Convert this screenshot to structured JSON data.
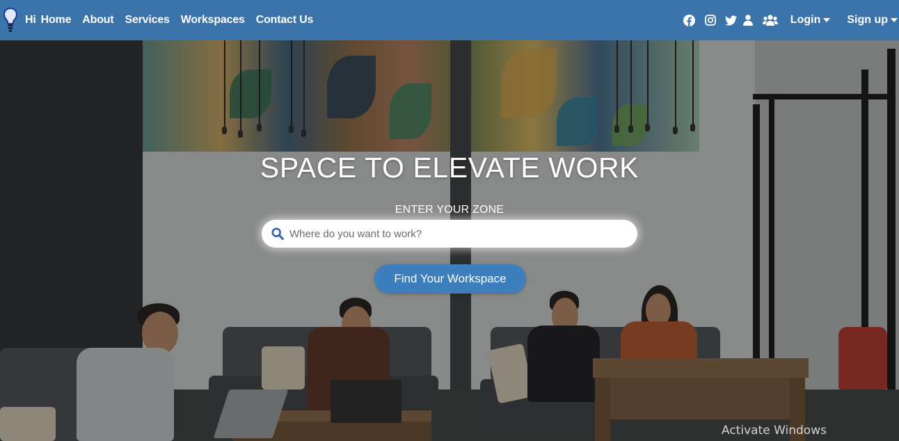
{
  "navbar": {
    "logo_icon": "lightbulb-icon",
    "links": [
      {
        "label": "Hi"
      },
      {
        "label": "Home"
      },
      {
        "label": "About"
      },
      {
        "label": "Services"
      },
      {
        "label": "Workspaces"
      },
      {
        "label": "Contact Us"
      }
    ],
    "social_icons": [
      "facebook-icon",
      "instagram-icon",
      "twitter-icon",
      "user-icon",
      "users-icon"
    ],
    "login_label": "Login",
    "signup_label": "Sign up",
    "background_color": "#3a76b2"
  },
  "hero": {
    "title": "SPACE TO ELEVATE WORK",
    "subtitle": "ENTER YOUR ZONE",
    "search": {
      "placeholder": "Where do you want to work?",
      "value": ""
    },
    "cta_label": "Find Your Workspace",
    "cta_color": "#3d7ebd"
  },
  "os_watermark": "Activate Windows"
}
